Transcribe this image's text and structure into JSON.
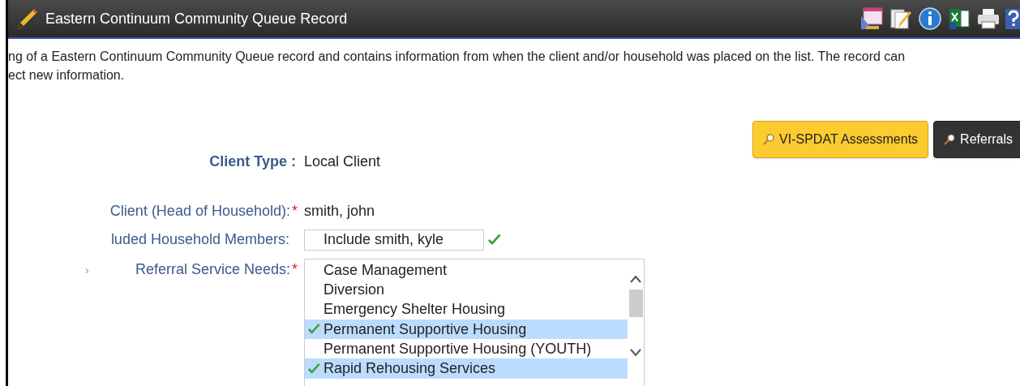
{
  "window": {
    "title": "Eastern Continuum Community Queue Record"
  },
  "intro": [
    "ng of a Eastern Continuum Community Queue record and contains information from when the client and/or household was placed on the list.   The record can",
    "ect new information."
  ],
  "buttons": [
    {
      "label": "VI-SPDAT Assessments",
      "kind": "primary"
    },
    {
      "label": "Referrals",
      "kind": "dark"
    }
  ],
  "form": {
    "client_type": {
      "label": "Client Type :",
      "value": "Local Client"
    },
    "client": {
      "label": "Client (Head of Household):",
      "required_mark": "*",
      "value": "smith, john"
    },
    "members": {
      "label": "luded Household Members:",
      "value": "Include smith, kyle"
    },
    "service_needs": {
      "mark": "›",
      "label": "Referral Service Needs:",
      "required_mark": "*",
      "options": [
        {
          "label": "Case Management",
          "selected": false
        },
        {
          "label": "Diversion",
          "selected": false
        },
        {
          "label": "Emergency Shelter Housing",
          "selected": false
        },
        {
          "label": "Permanent Supportive Housing",
          "selected": true
        },
        {
          "label": "Permanent Supportive Housing (YOUTH)",
          "selected": false
        },
        {
          "label": "Rapid Rehousing Services",
          "selected": true
        }
      ]
    }
  }
}
